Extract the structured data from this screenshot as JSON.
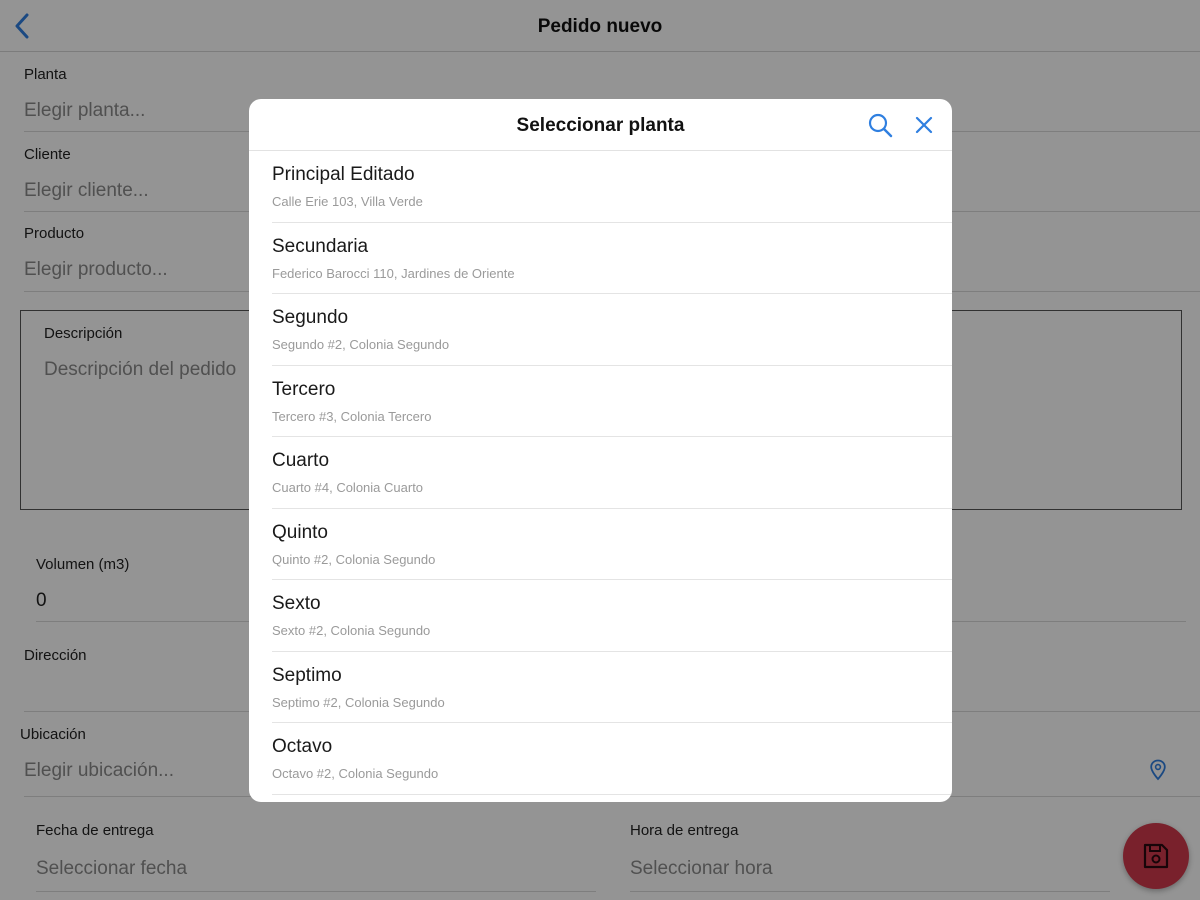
{
  "header": {
    "title": "Pedido nuevo"
  },
  "form": {
    "planta": {
      "label": "Planta",
      "placeholder": "Elegir planta..."
    },
    "cliente": {
      "label": "Cliente",
      "placeholder": "Elegir cliente..."
    },
    "producto": {
      "label": "Producto",
      "placeholder": "Elegir producto..."
    },
    "descripcion": {
      "label": "Descripción",
      "placeholder": "Descripción del pedido"
    },
    "volumen": {
      "label": "Volumen (m3)",
      "value": "0"
    },
    "direccion": {
      "label": "Dirección",
      "value": ""
    },
    "ubicacion": {
      "label": "Ubicación",
      "placeholder": "Elegir ubicación..."
    },
    "fecha": {
      "label": "Fecha de entrega",
      "placeholder": "Seleccionar fecha"
    },
    "hora": {
      "label": "Hora de entrega",
      "placeholder": "Seleccionar hora"
    }
  },
  "modal": {
    "title": "Seleccionar planta",
    "items": [
      {
        "name": "Principal Editado",
        "address": "Calle Erie 103, Villa Verde"
      },
      {
        "name": "Secundaria",
        "address": "Federico Barocci 110, Jardines de Oriente"
      },
      {
        "name": "Segundo",
        "address": "Segundo #2, Colonia Segundo"
      },
      {
        "name": "Tercero",
        "address": "Tercero #3, Colonia Tercero"
      },
      {
        "name": "Cuarto",
        "address": "Cuarto #4, Colonia Cuarto"
      },
      {
        "name": "Quinto",
        "address": "Quinto #2, Colonia Segundo"
      },
      {
        "name": "Sexto",
        "address": "Sexto #2, Colonia Segundo"
      },
      {
        "name": "Septimo",
        "address": "Septimo #2, Colonia Segundo"
      },
      {
        "name": "Octavo",
        "address": "Octavo #2, Colonia Segundo"
      }
    ]
  },
  "icons": {
    "back": "chevron-left-icon",
    "search": "search-icon",
    "close": "close-icon",
    "location": "location-pin-icon",
    "save": "save-icon"
  },
  "colors": {
    "accent": "#2f7fe0",
    "fab": "#d03a4c",
    "overlay": "rgba(0,0,0,0.42)"
  }
}
